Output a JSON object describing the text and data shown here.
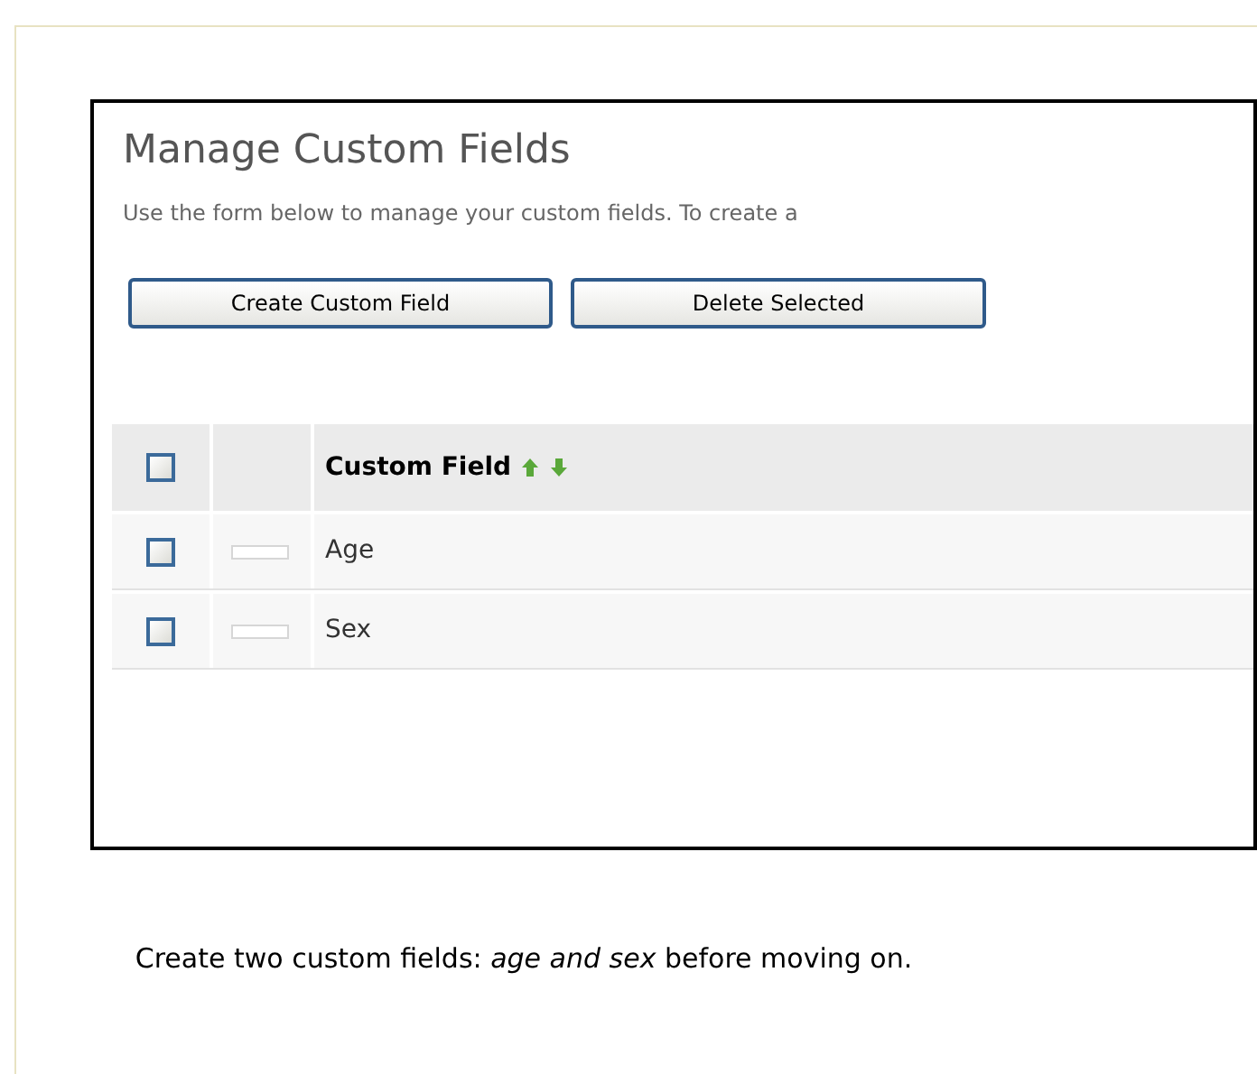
{
  "screenshot": {
    "title": "Manage Custom Fields",
    "description": "Use the form below to manage your custom fields. To create a",
    "buttons": [
      "Create Custom Field",
      "Delete Selected"
    ],
    "table": {
      "header": {
        "checked": false,
        "label": "Custom Field"
      },
      "rows": [
        {
          "checked": false,
          "name": "Age"
        },
        {
          "checked": false,
          "name": "Sex"
        }
      ]
    }
  },
  "caption": "Create two custom fields: *age and sex* before moving on."
}
